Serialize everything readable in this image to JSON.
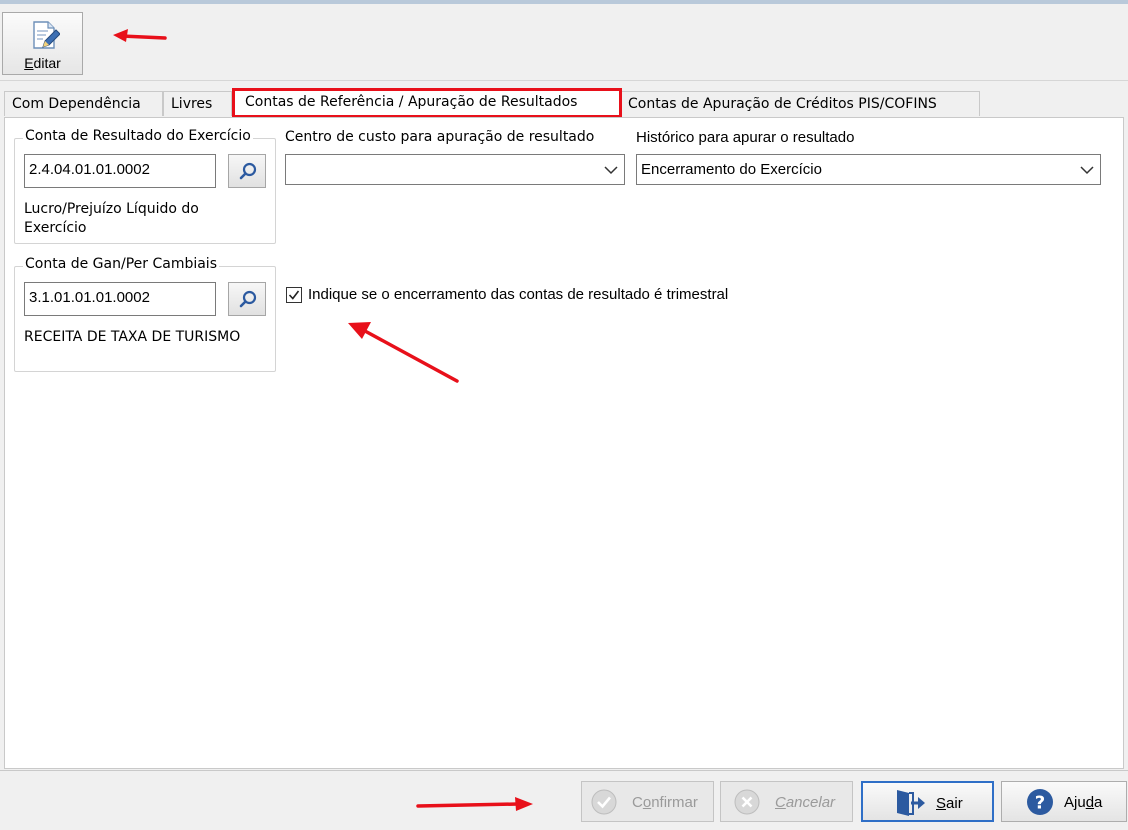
{
  "toolbar": {
    "edit_label_accel": "E",
    "edit_label_rest": "ditar"
  },
  "tabs": [
    {
      "label": "Com Dependência"
    },
    {
      "label": "Livres"
    },
    {
      "label": "Contas de Referência / Apuração de Resultados"
    },
    {
      "label": "Contas de Apuração de Créditos PIS/COFINS"
    }
  ],
  "resultado_exercicio": {
    "title": "Conta de Resultado do Exercício",
    "value": "2.4.04.01.01.0002",
    "description": "Lucro/Prejuízo Líquido do Exercício"
  },
  "gan_per_cambiais": {
    "title": "Conta de Gan/Per Cambiais",
    "value": "3.1.01.01.01.0002",
    "description": "RECEITA DE TAXA DE TURISMO"
  },
  "centro_custo": {
    "label": "Centro de custo para apuração de resultado",
    "value": ""
  },
  "historico": {
    "label": "Histórico para apurar o resultado",
    "value": "Encerramento do Exercício"
  },
  "trimestral_checkbox": {
    "label": "Indique se o encerramento das contas de resultado é trimestral",
    "checked": true
  },
  "footer": {
    "confirmar": {
      "accel": "o",
      "pre": "C",
      "post": "nfirmar"
    },
    "cancelar": {
      "accel": "C",
      "pre": "",
      "post": "ancelar"
    },
    "sair": {
      "accel": "S",
      "pre": "",
      "post": "air"
    },
    "ajuda": {
      "accel": "d",
      "pre": "Aju",
      "post": "a"
    }
  },
  "colors": {
    "annotation_red": "#e8101a",
    "focus_blue": "#2f6fc7",
    "icon_blue": "#2c5aa0"
  }
}
